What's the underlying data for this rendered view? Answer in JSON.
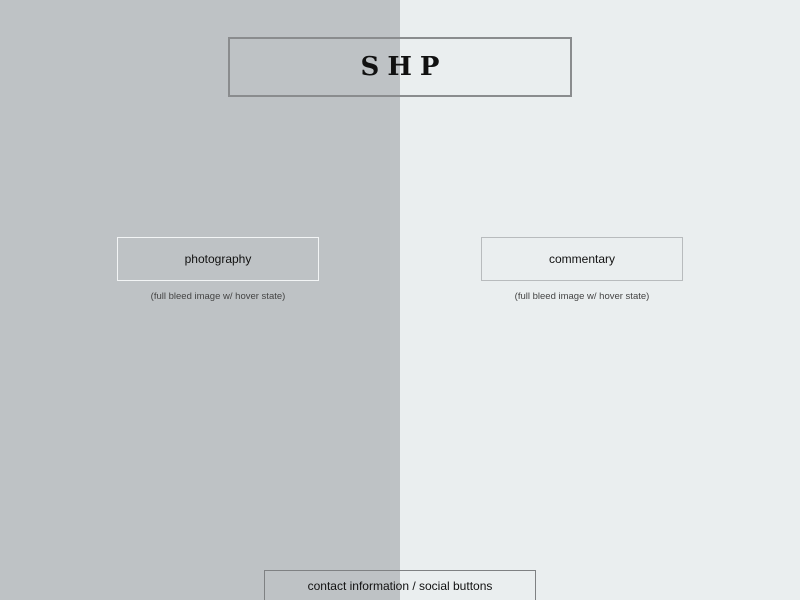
{
  "header": {
    "logo_text": "SHP"
  },
  "sections": {
    "photography": {
      "label": "photography",
      "caption": "(full bleed image w/ hover state)"
    },
    "commentary": {
      "label": "commentary",
      "caption": "(full bleed image w/ hover state)"
    }
  },
  "footer": {
    "label": "contact information / social buttons"
  },
  "colors": {
    "left_panel": "#bec2c5",
    "right_panel": "#eaeeef",
    "logo_border": "#8a8c8e"
  }
}
